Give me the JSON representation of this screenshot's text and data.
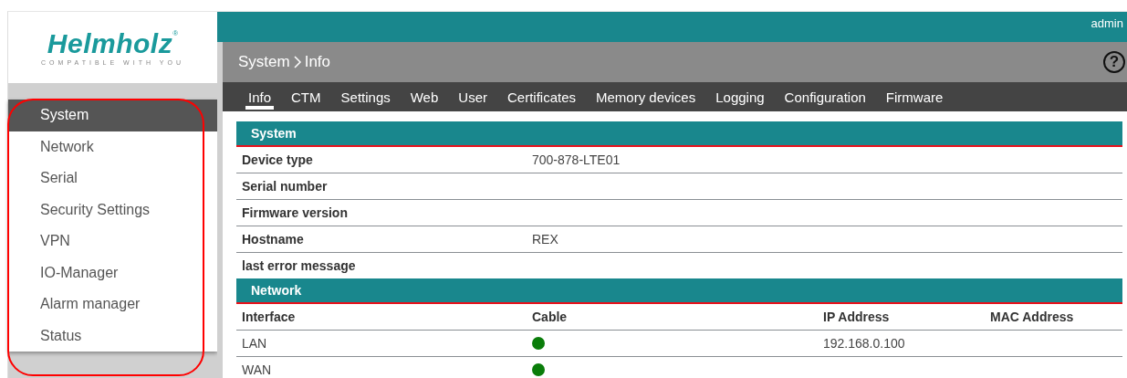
{
  "logo": {
    "brand": "Helmholz",
    "mark": "®",
    "tagline": "COMPATIBLE WITH YOU"
  },
  "top_bar": {
    "user": "admin"
  },
  "sidebar": {
    "items": [
      {
        "label": "System",
        "selected": true
      },
      {
        "label": "Network",
        "selected": false
      },
      {
        "label": "Serial",
        "selected": false
      },
      {
        "label": "Security Settings",
        "selected": false
      },
      {
        "label": "VPN",
        "selected": false
      },
      {
        "label": "IO-Manager",
        "selected": false
      },
      {
        "label": "Alarm manager",
        "selected": false
      },
      {
        "label": "Status",
        "selected": false
      }
    ]
  },
  "header": {
    "breadcrumb": [
      "System",
      "Info"
    ],
    "help": "?"
  },
  "tabs": [
    {
      "label": "Info",
      "selected": true
    },
    {
      "label": "CTM",
      "selected": false
    },
    {
      "label": "Settings",
      "selected": false
    },
    {
      "label": "Web",
      "selected": false
    },
    {
      "label": "User",
      "selected": false
    },
    {
      "label": "Certificates",
      "selected": false
    },
    {
      "label": "Memory devices",
      "selected": false
    },
    {
      "label": "Logging",
      "selected": false
    },
    {
      "label": "Configuration",
      "selected": false
    },
    {
      "label": "Firmware",
      "selected": false
    }
  ],
  "system": {
    "title": "System",
    "rows": [
      {
        "label": "Device type",
        "value": "700-878-LTE01"
      },
      {
        "label": "Serial number"
      },
      {
        "label": "Firmware version"
      },
      {
        "label": "Hostname",
        "value": "REX"
      },
      {
        "label": "last error message"
      }
    ]
  },
  "network": {
    "title": "Network",
    "columns": [
      "Interface",
      "Cable",
      "IP Address",
      "MAC Address"
    ],
    "rows": [
      {
        "interface": "LAN",
        "color": "#0a7d0a",
        "ip": "192.168.0.100"
      },
      {
        "interface": "WAN",
        "color": "#0a7d0a"
      }
    ]
  },
  "annotation": {
    "kind": "outline"
  }
}
